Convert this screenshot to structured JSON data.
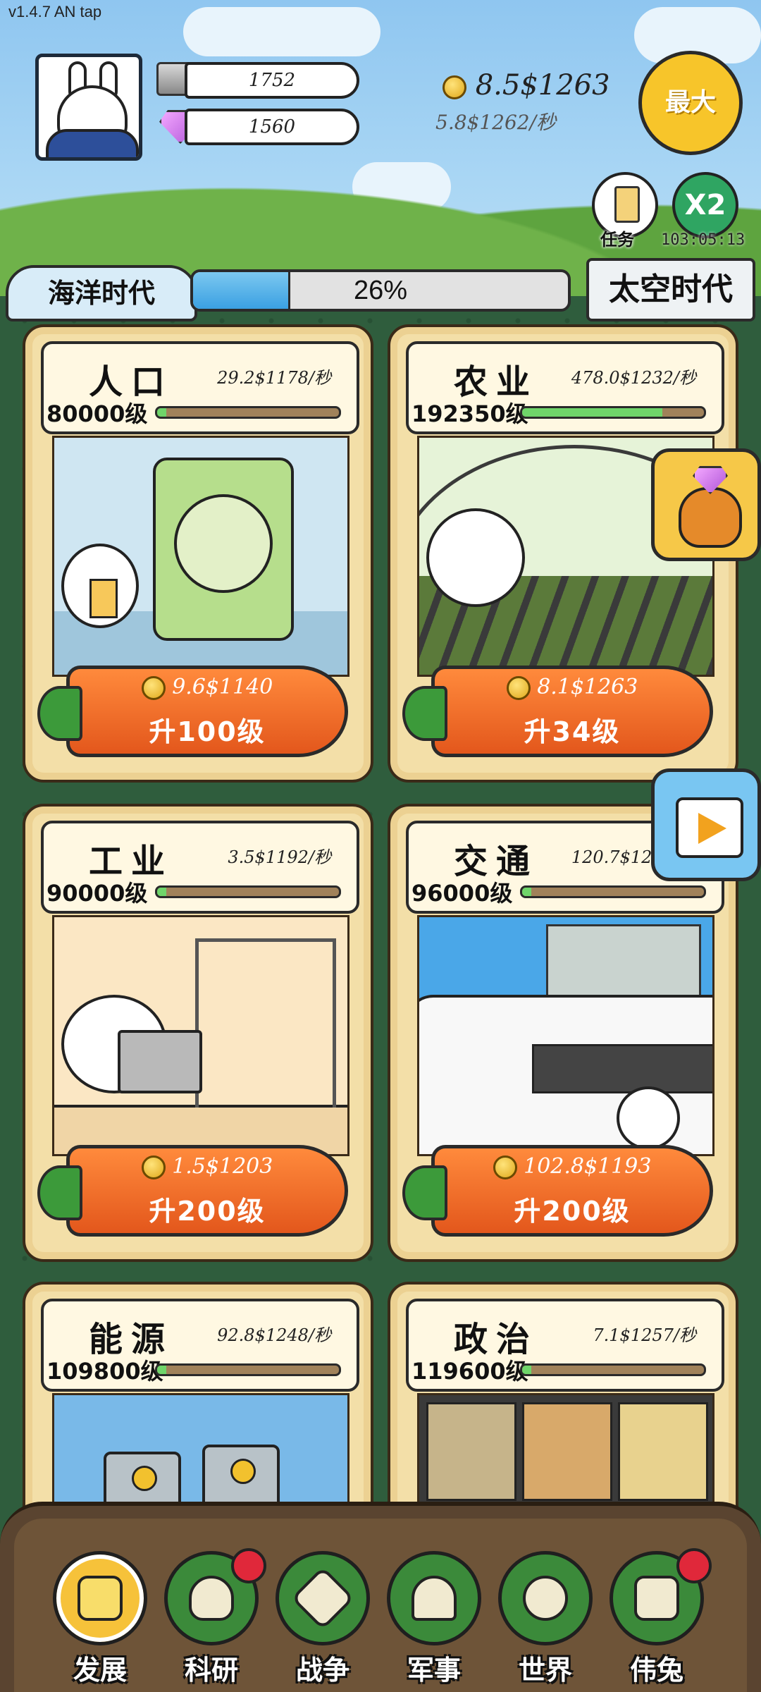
{
  "version": "v1.4.7 AN tap",
  "hud": {
    "silver": "1752",
    "gems": "1560",
    "gold": "8.5$1263",
    "gold_rate": "5.8$1262/秒",
    "max_label": "最大",
    "task_label": "任务",
    "x2_label": "X2",
    "timer": "103:05:13"
  },
  "era": {
    "current": "海洋时代",
    "next": "太空时代",
    "progress": 26,
    "progress_label": "26%"
  },
  "cards": [
    {
      "title": "人口",
      "rate": "29.2$1178/秒",
      "level": "80000级",
      "level_fill": 0.05,
      "cost": "9.6$1140",
      "upgrade": "升100级"
    },
    {
      "title": "农业",
      "rate": "478.0$1232/秒",
      "level": "192350级",
      "level_fill": 0.77,
      "cost": "8.1$1263",
      "upgrade": "升34级"
    },
    {
      "title": "工业",
      "rate": "3.5$1192/秒",
      "level": "90000级",
      "level_fill": 0.05,
      "cost": "1.5$1203",
      "upgrade": "升200级"
    },
    {
      "title": "交通",
      "rate": "120.7$1201/秒",
      "level": "96000级",
      "level_fill": 0.05,
      "cost": "102.8$1193",
      "upgrade": "升200级"
    },
    {
      "title": "能源",
      "rate": "92.8$1248/秒",
      "level": "109800级",
      "level_fill": 0.05,
      "cost": "",
      "upgrade": ""
    },
    {
      "title": "政治",
      "rate": "7.1$1257/秒",
      "level": "119600级",
      "level_fill": 0.05,
      "cost": "",
      "upgrade": ""
    }
  ],
  "nav": [
    {
      "label": "发展",
      "active": true,
      "badge": false
    },
    {
      "label": "科研",
      "active": false,
      "badge": true
    },
    {
      "label": "战争",
      "active": false,
      "badge": false
    },
    {
      "label": "军事",
      "active": false,
      "badge": false
    },
    {
      "label": "世界",
      "active": false,
      "badge": false
    },
    {
      "label": "伟兔",
      "active": false,
      "badge": true
    }
  ],
  "colors": {
    "accent": "#f6c23a",
    "carrot": "#ff7a2e",
    "progress": "#3aa0e2",
    "level_bar": "#6fd56a",
    "badge": "#e0283a"
  }
}
